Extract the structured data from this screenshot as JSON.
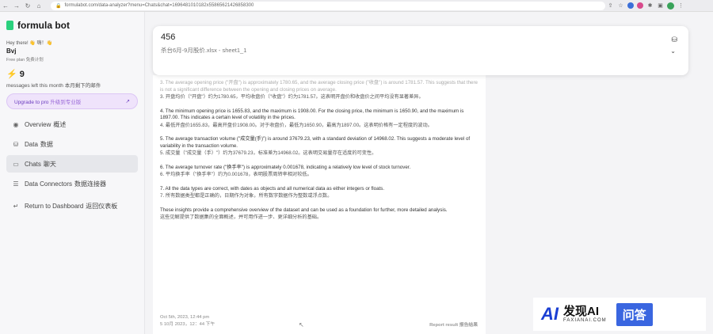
{
  "browser": {
    "url": "formulabot.com/data-analyzer?menu=Chats&chat=1696481010182x55865621426858300"
  },
  "sidebar": {
    "logo": "formula bot",
    "greeting": "Hey there! 👋 嗨！👋",
    "username": "Bvj",
    "plan": "Free plan 免费计划",
    "credits": "9",
    "credits_sub": "messages left this month 本月剩下的邮件",
    "upgrade_label": "Upgrade to pro",
    "upgrade_zh": "升级到专业版",
    "upgrade_arrow": "↗",
    "items": [
      {
        "label": "Overview",
        "zh": "概述",
        "icon": "eye-icon"
      },
      {
        "label": "Data",
        "zh": "数据",
        "icon": "database-icon"
      },
      {
        "label": "Chats",
        "zh": "聊天",
        "icon": "chat-icon"
      },
      {
        "label": "Data Connectors",
        "zh": "数据连接器",
        "icon": "list-icon"
      },
      {
        "label": "Return to Dashboard",
        "zh": "返回仪表板",
        "icon": "return-icon"
      }
    ]
  },
  "chat": {
    "title": "456",
    "file": "杀台6月-9月股价.xlsx - sheet1_1",
    "paragraphs": [
      {
        "en": "3. The average opening price (\"开盘\") is approximately 1780.65, and the average closing price (\"收盘\") is around 1781.57. This suggests that there is not a significant difference between the opening and closing prices on average.",
        "zh": "3. 开盘均价（\"开盘\"）约为1780.65，平均收盘价（\"收盘\"）约为1781.57。这表明开盘价和收盘价之间平均没有显著差异。"
      },
      {
        "en": "4. The minimum opening price is 1655.83, and the maximum is 1908.00. For the closing price, the minimum is 1650.90, and the maximum is 1897.00. This indicates a certain level of volatility in the prices.",
        "zh": "4. 最低开盘价1655.83，最高开盘价1908.00。对于收盘价，最低为1650.90，最高为1897.00。这表明价格有一定程度的波动。"
      },
      {
        "en": "5. The average transaction volume (\"成交量(手)\") is around 37679.23, with a standard deviation of 14968.02. This suggests a moderate level of variability in the transaction volume.",
        "zh": "5. 成交量（\"成交量（手）\"）约为37679.23，标准差为14968.02。这表明交易量存在适度的可变性。"
      },
      {
        "en": "6. The average turnover rate (\"换手率\") is approximately 0.001678, indicating a relatively low level of stock turnover.",
        "zh": "6. 平均换手率（\"换手率\"）约为0.001678，表明股票周转率相对较低。"
      },
      {
        "en": "7. All the data types are correct, with dates as objects and all numerical data as either integers or floats.",
        "zh": "7. 所有数据类型都是正确的，日期作为对象，所有数字数据作为整数或浮点数。"
      },
      {
        "en": "These insights provide a comprehensive overview of the dataset and can be used as a foundation for further, more detailed analysis.",
        "zh": "这些见解提供了数据集的全面概述，并可用作进一步、更详细分析的基础。"
      }
    ],
    "timestamp": "Oct 5th, 2023, 12:44 pm",
    "timestamp_zh": "5 10月 2023，12：44 下午",
    "report": "Report result",
    "report_zh": "报告结果"
  },
  "watermark": {
    "logo": "AI",
    "big": "发现AI",
    "small": "FAXIANAI.COM",
    "box": "问答"
  }
}
